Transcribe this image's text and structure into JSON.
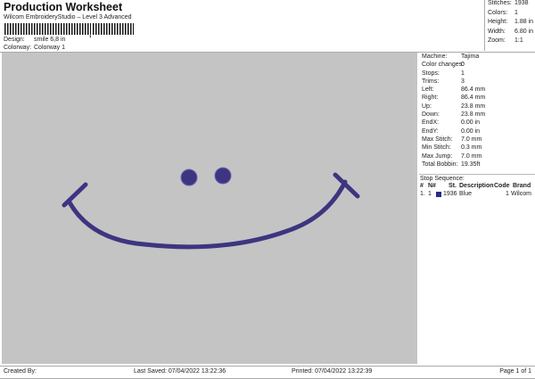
{
  "header": {
    "title": "Production Worksheet",
    "software": "Wilcom EmbroideryStudio – Level 3 Advanced",
    "design_label": "Design:",
    "design": "smile 6,8 in",
    "colorway_label": "Colorway:",
    "colorway": "Colorway 1"
  },
  "summary": [
    {
      "k": "Stitches:",
      "v": "1938"
    },
    {
      "k": "Colors:",
      "v": "1"
    },
    {
      "k": "Height:",
      "v": "1.88 in"
    },
    {
      "k": "Width:",
      "v": "6.80 in"
    },
    {
      "k": "Zoom:",
      "v": "1:1"
    }
  ],
  "details": [
    {
      "k": "Machine:",
      "v": "Tajima"
    },
    {
      "k": "Color changes:",
      "v": "0"
    },
    {
      "k": "Stops:",
      "v": "1"
    },
    {
      "k": "Trims:",
      "v": "3"
    },
    {
      "k": "Left:",
      "v": "86.4 mm"
    },
    {
      "k": "Right:",
      "v": "86.4 mm"
    },
    {
      "k": "Up:",
      "v": "23.8 mm"
    },
    {
      "k": "Down:",
      "v": "23.8 mm"
    },
    {
      "k": "EndX:",
      "v": "0.00 in"
    },
    {
      "k": "EndY:",
      "v": "0.00 in"
    },
    {
      "k": "Max Stitch:",
      "v": "7.0 mm"
    },
    {
      "k": "Min Stitch:",
      "v": "0.3 mm"
    },
    {
      "k": "Max Jump:",
      "v": "7.0 mm"
    },
    {
      "k": "Total Bobbin:",
      "v": "19.35ft"
    }
  ],
  "stop_sequence": {
    "title": "Stop Sequence:",
    "headers": [
      "#",
      "N#",
      "St.",
      "Description",
      "Code",
      "Brand"
    ],
    "rows": [
      {
        "num": "1.",
        "n": "1",
        "st": "1936",
        "desc": "Blue",
        "code": "1",
        "brand": "Wilcom",
        "swatch": "#2a2a8a"
      }
    ]
  },
  "colors": {
    "thread": "#3d3580",
    "canvas": "#c4c4c4"
  },
  "footer": {
    "created": "Created By:",
    "saved": "Last Saved: 07/04/2022 13:22:36",
    "printed": "Printed: 07/04/2022 13:22:39",
    "page": "Page 1 of 1"
  }
}
